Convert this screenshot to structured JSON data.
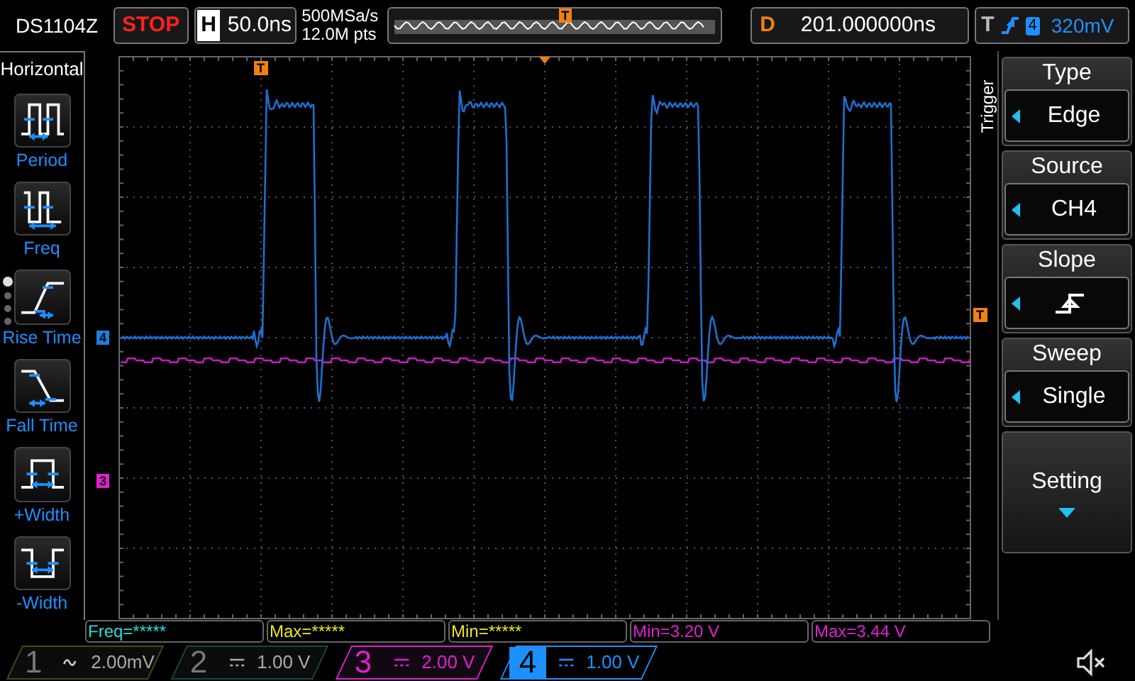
{
  "model": "DS1104Z",
  "run_state": {
    "label": "STOP",
    "running": false
  },
  "timebase": {
    "label": "H",
    "value": "50.0ns"
  },
  "timeline": {
    "marker": "T"
  },
  "acquisition": {
    "sample_rate": "500MSa/s",
    "memory_depth": "12.0M pts"
  },
  "delay": {
    "label": "D",
    "value": "201.000000ns"
  },
  "trigger_status": {
    "label": "T",
    "kind": "rising",
    "source": "4",
    "level": "320mV"
  },
  "left_menu": {
    "title": "Horizontal",
    "items": [
      {
        "label": "Period",
        "kind": "period"
      },
      {
        "label": "Freq",
        "kind": "freq"
      },
      {
        "label": "Rise Time",
        "kind": "rise"
      },
      {
        "label": "Fall Time",
        "kind": "fall"
      },
      {
        "label": "+Width",
        "kind": "pwidth"
      },
      {
        "label": "-Width",
        "kind": "nwidth"
      }
    ],
    "pages": [
      {
        "selected": true
      },
      {
        "selected": false
      },
      {
        "selected": false
      },
      {
        "selected": false
      }
    ]
  },
  "screen_markers": {
    "trigger_position": "T",
    "trigger_level": "T",
    "channels": [
      {
        "label": "4",
        "color": "#1e7fe0"
      },
      {
        "label": "3",
        "color": "#e020d0"
      }
    ]
  },
  "right_menu": {
    "title": "Trigger",
    "items": [
      {
        "label": "Type",
        "kind": "value",
        "value": "Edge"
      },
      {
        "label": "Source",
        "kind": "value",
        "value": "CH4"
      },
      {
        "label": "Slope",
        "kind": "slope"
      },
      {
        "label": "Sweep",
        "kind": "value",
        "value": "Single"
      },
      {
        "label": "Setting",
        "kind": "submenu"
      }
    ]
  },
  "measurements": [
    {
      "text": "Freq=*****",
      "color": "#20e0e0"
    },
    {
      "text": "Max=*****",
      "color": "#e8e820"
    },
    {
      "text": "Min=*****",
      "color": "#e8e820"
    },
    {
      "text": "Min=3.20 V",
      "color": "#e020d0"
    },
    {
      "text": "Max=3.44 V",
      "color": "#e020d0"
    }
  ],
  "channels": [
    {
      "number": "1",
      "kind": "ac",
      "scale": "2.00mV",
      "color": "#4a4a12",
      "enabled": false,
      "selected": false
    },
    {
      "number": "2",
      "kind": "dc",
      "scale": "1.00 V",
      "color": "#124a4a",
      "enabled": false,
      "selected": false
    },
    {
      "number": "3",
      "kind": "dc",
      "scale": "2.00 V",
      "color": "#e020d0",
      "enabled": true,
      "selected": false
    },
    {
      "number": "4",
      "kind": "dc",
      "scale": "1.00 V",
      "color": "#1e8fff",
      "enabled": true,
      "selected": true
    }
  ],
  "sound": {
    "muted": true
  }
}
